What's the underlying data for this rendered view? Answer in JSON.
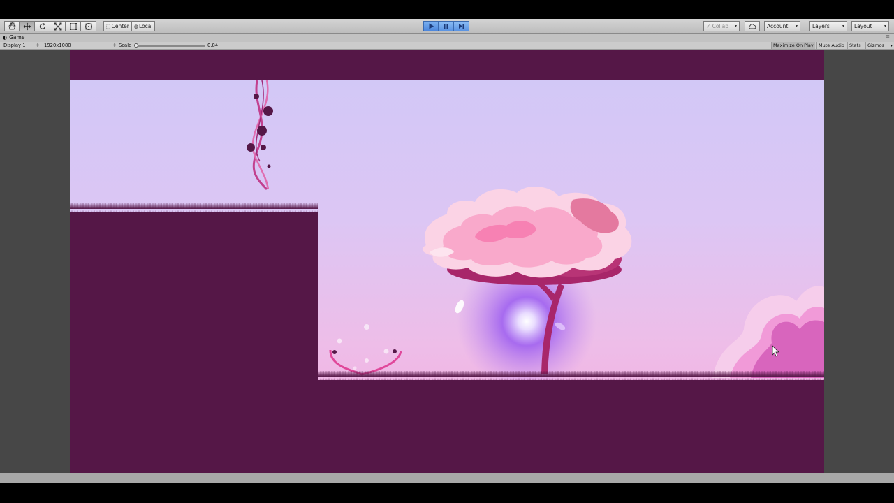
{
  "toolbar": {
    "transform_tools": [
      "hand-tool",
      "move-tool",
      "rotate-tool",
      "scale-tool",
      "rect-tool",
      "transform-tool"
    ],
    "pivot_mode": "Center",
    "pivot_space": "Local",
    "collab_label": "Collab",
    "account_label": "Account",
    "layers_label": "Layers",
    "layout_label": "Layout"
  },
  "game_view": {
    "tab_label": "Game",
    "display_label": "Display 1",
    "resolution_label": "1920x1080",
    "scale_label": "Scale",
    "scale_value": "0.84",
    "maximize_label": "Maximize On Play",
    "mute_label": "Mute Audio",
    "stats_label": "Stats",
    "gizmos_label": "Gizmos"
  },
  "colors": {
    "ground": "#551747",
    "sky_top": "#d0c8f7",
    "sky_bottom": "#f5a6de",
    "tree_pink": "#f9a9cb",
    "bush": "#e070c4",
    "orb": "#9b5cf0",
    "play_accent": "#4c86dc"
  }
}
